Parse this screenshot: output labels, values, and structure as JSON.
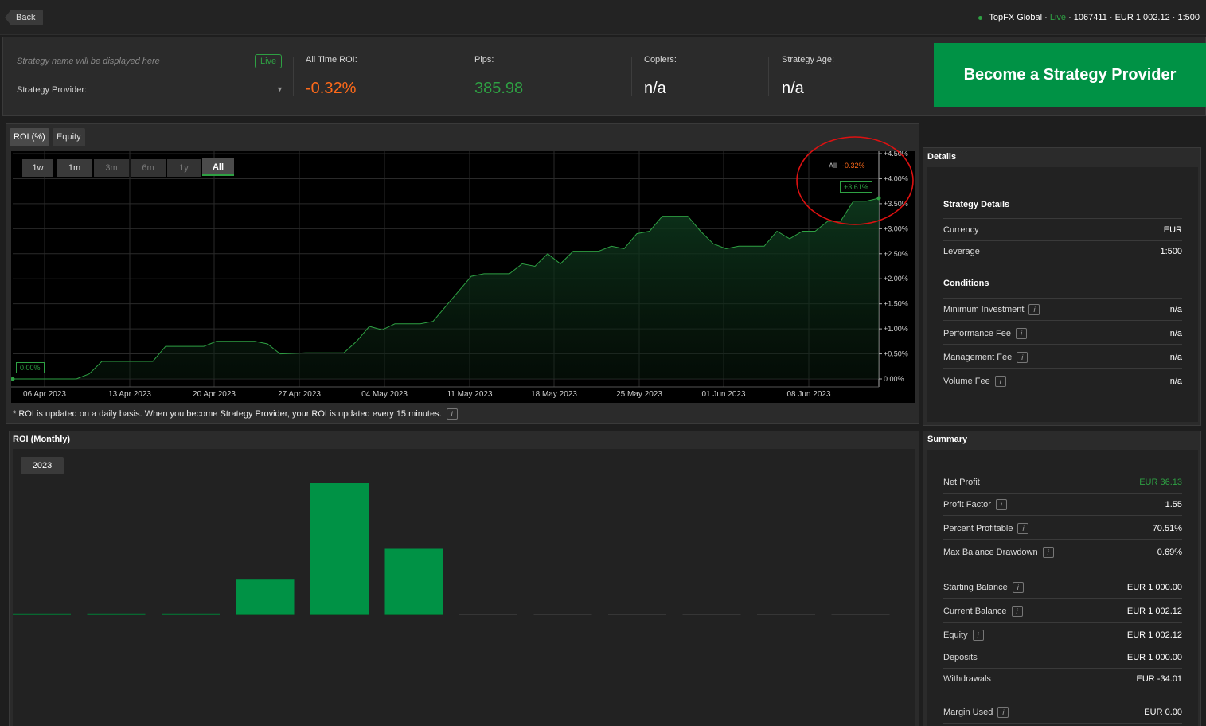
{
  "topbar": {
    "back_label": "Back",
    "broker": "TopFX Global",
    "sep1": " · ",
    "status": "Live",
    "account_rest": " · 1067411 · EUR 1 002.12 · 1:500"
  },
  "header": {
    "strategy_name_placeholder": "Strategy name will be displayed here",
    "live_badge": "Live",
    "provider_label": "Strategy Provider:",
    "stats": [
      {
        "label": "All Time ROI:",
        "value": "-0.32%",
        "color": "#ff6a1a"
      },
      {
        "label": "Pips:",
        "value": "385.98",
        "color": "#2ea043"
      },
      {
        "label": "Copiers:",
        "value": "n/a",
        "color": "#ffffff"
      },
      {
        "label": "Strategy Age:",
        "value": "n/a",
        "color": "#ffffff"
      }
    ],
    "become_button": "Become a Strategy Provider"
  },
  "roi_panel": {
    "tabs": [
      "ROI (%)",
      "Equity"
    ],
    "ranges": [
      "1w",
      "1m",
      "3m",
      "6m",
      "1y",
      "All"
    ],
    "legend_period": "All",
    "legend_value": "-0.32%",
    "current_badge": "+3.61%",
    "start_badge": "0.00%",
    "footnote": "* ROI is updated on a daily basis. When you become Strategy Provider, your ROI is updated every 15 minutes."
  },
  "chart_data": {
    "type": "area",
    "y_ticks": [
      "+4.50%",
      "+4.00%",
      "+3.50%",
      "+3.00%",
      "+2.50%",
      "+2.00%",
      "+1.50%",
      "+1.00%",
      "+0.50%",
      "0.00%"
    ],
    "x_ticks": [
      "06 Apr 2023",
      "13 Apr 2023",
      "20 Apr 2023",
      "27 Apr 2023",
      "04 May 2023",
      "11 May 2023",
      "18 May 2023",
      "25 May 2023",
      "01 Jun 2023",
      "08 Jun 2023"
    ],
    "ylim": [
      0,
      4.5
    ],
    "grid": true,
    "line_color": "#2ea043",
    "points": [
      [
        0,
        0
      ],
      [
        5,
        0
      ],
      [
        6,
        0.1
      ],
      [
        7,
        0.35
      ],
      [
        8,
        0.35
      ],
      [
        11,
        0.35
      ],
      [
        12,
        0.65
      ],
      [
        15,
        0.65
      ],
      [
        16,
        0.75
      ],
      [
        19,
        0.75
      ],
      [
        20,
        0.7
      ],
      [
        21,
        0.5
      ],
      [
        23,
        0.52
      ],
      [
        26,
        0.52
      ],
      [
        27,
        0.75
      ],
      [
        28,
        1.05
      ],
      [
        29,
        0.98
      ],
      [
        30,
        1.1
      ],
      [
        32,
        1.1
      ],
      [
        33,
        1.15
      ],
      [
        34,
        1.45
      ],
      [
        35,
        1.75
      ],
      [
        36,
        2.05
      ],
      [
        37,
        2.1
      ],
      [
        39,
        2.1
      ],
      [
        40,
        2.3
      ],
      [
        41,
        2.25
      ],
      [
        42,
        2.5
      ],
      [
        43,
        2.3
      ],
      [
        44,
        2.55
      ],
      [
        46,
        2.55
      ],
      [
        47,
        2.65
      ],
      [
        48,
        2.6
      ],
      [
        49,
        2.9
      ],
      [
        50,
        2.95
      ],
      [
        51,
        3.25
      ],
      [
        53,
        3.25
      ],
      [
        54,
        2.95
      ],
      [
        55,
        2.7
      ],
      [
        56,
        2.6
      ],
      [
        57,
        2.65
      ],
      [
        58,
        2.65
      ],
      [
        59,
        2.65
      ],
      [
        60,
        2.95
      ],
      [
        61,
        2.8
      ],
      [
        62,
        2.95
      ],
      [
        63,
        2.95
      ],
      [
        64,
        3.15
      ],
      [
        65,
        3.15
      ],
      [
        66,
        3.55
      ],
      [
        67,
        3.55
      ],
      [
        68,
        3.61
      ]
    ]
  },
  "details": {
    "title": "Details",
    "strategy_details_heading": "Strategy Details",
    "strategy_details": [
      {
        "k": "Currency",
        "v": "EUR"
      },
      {
        "k": "Leverage",
        "v": "1:500"
      }
    ],
    "conditions_heading": "Conditions",
    "conditions": [
      {
        "k": "Minimum Investment",
        "v": "n/a"
      },
      {
        "k": "Performance Fee",
        "v": "n/a"
      },
      {
        "k": "Management Fee",
        "v": "n/a"
      },
      {
        "k": "Volume Fee",
        "v": "n/a"
      }
    ]
  },
  "monthly": {
    "title": "ROI (Monthly)",
    "year": "2023",
    "bars": [
      0.01,
      0.01,
      0.01,
      0.38,
      1.4,
      0.7,
      0,
      0,
      0,
      0,
      0,
      0
    ],
    "bar_color": "#009245"
  },
  "summary": {
    "title": "Summary",
    "rows": [
      {
        "k": "Net Profit",
        "v": "EUR 36.13",
        "info": false,
        "green": true
      },
      {
        "k": "Profit Factor",
        "v": "1.55",
        "info": true
      },
      {
        "k": "Percent Profitable",
        "v": "70.51%",
        "info": true
      },
      {
        "k": "Max Balance Drawdown",
        "v": "0.69%",
        "info": true
      },
      {
        "k": "Starting Balance",
        "v": "EUR 1 000.00",
        "info": true
      },
      {
        "k": "Current Balance",
        "v": "EUR 1 002.12",
        "info": true
      },
      {
        "k": "Equity",
        "v": "EUR 1 002.12",
        "info": true
      },
      {
        "k": "Deposits",
        "v": "EUR 1 000.00",
        "info": false
      },
      {
        "k": "Withdrawals",
        "v": "EUR -34.01",
        "info": false
      },
      {
        "k": "Margin Used",
        "v": "EUR 0.00",
        "info": true
      }
    ]
  }
}
